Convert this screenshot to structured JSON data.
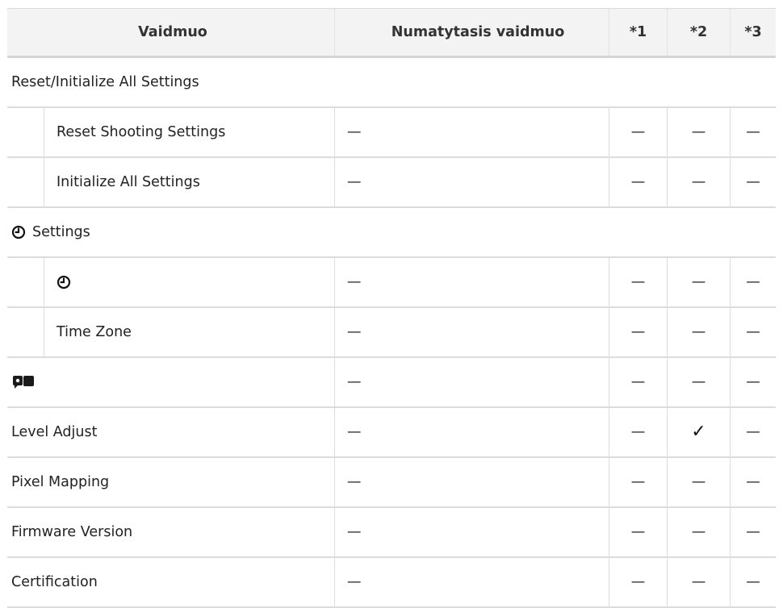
{
  "header": {
    "col_setting": "Vaidmuo",
    "col_default": "Numatytasis vaidmuo",
    "col_s1": "*1",
    "col_s2": "*2",
    "col_s3": "*3"
  },
  "rows": [
    {
      "kind": "section",
      "icon": "",
      "label": "Reset/Initialize All Settings"
    },
    {
      "kind": "sub",
      "icon": "",
      "label": "Reset Shooting Settings",
      "default": "—",
      "s1": "—",
      "s2": "—",
      "s3": "—"
    },
    {
      "kind": "sub",
      "icon": "",
      "label": "Initialize All Settings",
      "default": "—",
      "s1": "—",
      "s2": "—",
      "s3": "—"
    },
    {
      "kind": "section",
      "icon": "clock-icon",
      "label": "Settings"
    },
    {
      "kind": "sub",
      "icon": "clock-icon",
      "label": "",
      "default": "—",
      "s1": "—",
      "s2": "—",
      "s3": "—"
    },
    {
      "kind": "sub",
      "icon": "",
      "label": "Time Zone",
      "default": "—",
      "s1": "—",
      "s2": "—",
      "s3": "—"
    },
    {
      "kind": "item",
      "icon": "language-icon",
      "label": "",
      "default": "—",
      "s1": "—",
      "s2": "—",
      "s3": "—"
    },
    {
      "kind": "item",
      "icon": "",
      "label": "Level Adjust",
      "default": "—",
      "s1": "—",
      "s2": "✓",
      "s3": "—"
    },
    {
      "kind": "item",
      "icon": "",
      "label": "Pixel Mapping",
      "default": "—",
      "s1": "—",
      "s2": "—",
      "s3": "—"
    },
    {
      "kind": "item",
      "icon": "",
      "label": "Firmware Version",
      "default": "—",
      "s1": "—",
      "s2": "—",
      "s3": "—"
    },
    {
      "kind": "item",
      "icon": "",
      "label": "Certification",
      "default": "—",
      "s1": "—",
      "s2": "—",
      "s3": "—"
    }
  ]
}
